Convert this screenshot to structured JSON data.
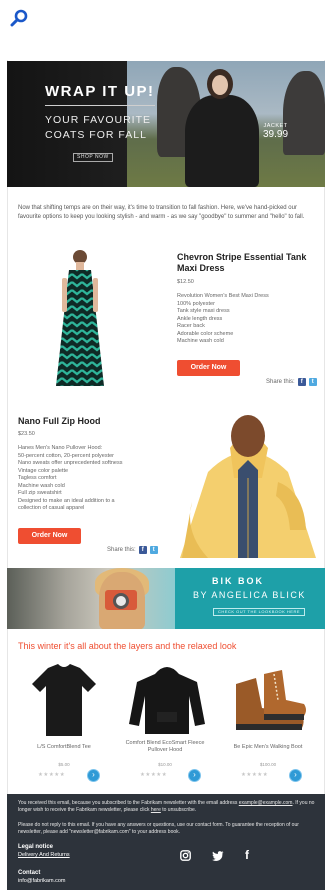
{
  "hero": {
    "headline": "WRAP IT UP!",
    "subhead": "YOUR FAVOURITE COATS FOR FALL",
    "cta": "SHOP NOW",
    "tag_label": "JACKET",
    "tag_price": "39.99"
  },
  "intro": "Now that shifting temps are on their way, it's time to transition to fall fashion. Here, we've hand-picked our favourite options to keep you looking stylish - and warm - as we say \"goodbye\" to summer and \"hello\" to fall.",
  "product1": {
    "title": "Chevron Stripe Essential Tank Maxi Dress",
    "price": "$12.50",
    "desc": [
      "Revolution Women's Best Maxi Dress",
      "100% polyester",
      "Tank style maxi dress",
      "Ankle length dress",
      "Racer back",
      "Adorable color scheme",
      "Machine wash cold"
    ],
    "button": "Order Now",
    "share": "Share this:"
  },
  "product2": {
    "title": "Nano Full Zip Hood",
    "price": "$23.50",
    "desc": [
      "Hanes Men's Nano Pullover Hood:",
      "50-percent cotton, 20-percent polyester",
      "Nano sweats offer unprecedented softness",
      "Vintage color palette",
      "Tagless comfort",
      "Machine wash cold",
      "Full zip sweatshirt",
      "Designed to make an ideal addition to a",
      "collection of casual apparel"
    ],
    "button": "Order Now",
    "share": "Share this:"
  },
  "banner": {
    "title": "BIK BOK",
    "subtitle": "BY ANGELICA BLICK",
    "cta": "CHECK OUT THE LOOKBOOK HERE"
  },
  "winter": {
    "heading": "This winter it's all about the layers and the relaxed look",
    "items": [
      {
        "name": "L/S ComfortBlend Tee",
        "price": "$5.00"
      },
      {
        "name": "Comfort Blend EcoSmart Fleece Pullover Hood",
        "price": "$10.00"
      },
      {
        "name": "Be Epic Men's Walking Boot",
        "price": "$100.00"
      }
    ],
    "stars": "★★★★★",
    "go_icon": "chevron-right-icon"
  },
  "footer": {
    "note1a": "You received this email, because you subscribed to the Fabrikam newsletter with the email address",
    "note1b": "example@example.com",
    "note1c": ". If you no longer wish to receive the Fabrikam newsletter, please click",
    "note1d": "here",
    "note1e": "to unsubscribe.",
    "note2": "Please do not reply to this email. If you have any answers or questions, use our contact form. To guarantee the reception of our newsletter, please add \"newsletter@fabrikam.com\" to your address book.",
    "legal_heading": "Legal notice",
    "legal_link": "Delivery And Returns",
    "contact_heading": "Contact",
    "contact_email": "info@fabrikam.com",
    "icons": [
      "instagram-icon",
      "twitter-icon",
      "facebook-icon"
    ]
  },
  "colors": {
    "accent": "#ef4e31",
    "footer": "#2d333b",
    "go": "#2f9ad6"
  }
}
